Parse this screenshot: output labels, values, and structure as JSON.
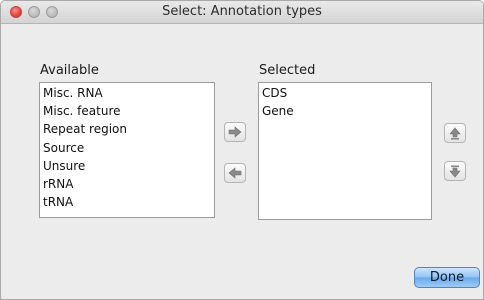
{
  "window": {
    "title": "Select: Annotation types"
  },
  "available": {
    "label": "Available",
    "items": [
      "Misc. RNA",
      "Misc. feature",
      "Repeat region",
      "Source",
      "Unsure",
      "rRNA",
      "tRNA"
    ]
  },
  "selected": {
    "label": "Selected",
    "items": [
      "CDS",
      "Gene"
    ]
  },
  "buttons": {
    "add_icon": "arrow-right-icon",
    "remove_icon": "arrow-left-icon",
    "move_up_icon": "arrow-up-icon",
    "move_down_icon": "arrow-down-icon",
    "done_label": "Done"
  }
}
